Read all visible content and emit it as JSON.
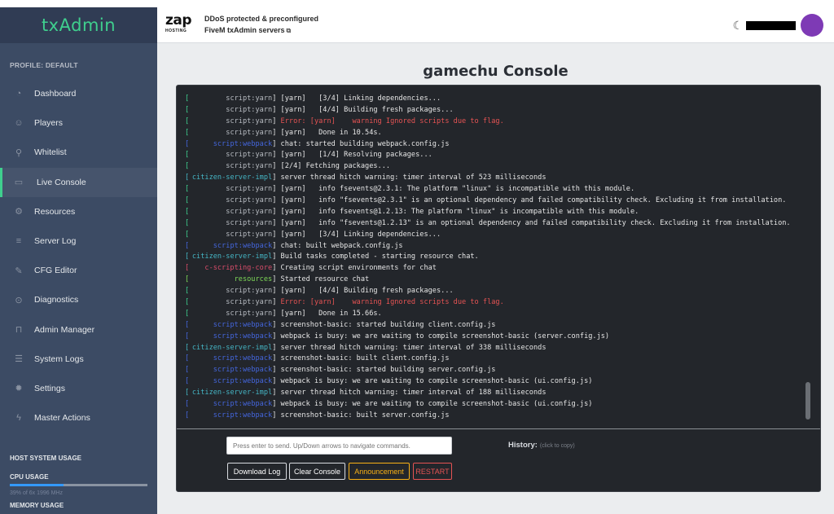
{
  "brand": {
    "name": "txAdmin",
    "accent": "#3fcf8e"
  },
  "sidebar": {
    "profile_title": "PROFILE: DEFAULT",
    "items": [
      {
        "label": "Dashboard",
        "icon": "speedometer-icon",
        "glyph": "◔"
      },
      {
        "label": "Players",
        "icon": "people-icon",
        "glyph": "☺"
      },
      {
        "label": "Whitelist",
        "icon": "user-icon",
        "glyph": "⚲"
      },
      {
        "label": "Live Console",
        "icon": "terminal-icon",
        "glyph": "▭",
        "active": true
      },
      {
        "label": "Resources",
        "icon": "puzzle-icon",
        "glyph": "⚙"
      },
      {
        "label": "Server Log",
        "icon": "list-icon",
        "glyph": "≡"
      },
      {
        "label": "CFG Editor",
        "icon": "pencil-icon",
        "glyph": "✎"
      },
      {
        "label": "Diagnostics",
        "icon": "medical-icon",
        "glyph": "⊙"
      },
      {
        "label": "Admin Manager",
        "icon": "book-icon",
        "glyph": "⊓"
      },
      {
        "label": "System Logs",
        "icon": "notes-icon",
        "glyph": "☰"
      },
      {
        "label": "Settings",
        "icon": "gear-icon",
        "glyph": "✹"
      },
      {
        "label": "Master Actions",
        "icon": "bolt-icon",
        "glyph": "ϟ"
      }
    ],
    "host_usage_title": "HOST SYSTEM USAGE",
    "cpu_title": "CPU USAGE",
    "cpu_usage_percent": 39,
    "cpu_detail": "39% of 6x 1996 MHz",
    "memory_title": "MEMORY USAGE"
  },
  "header": {
    "zap_logo_word": "zap",
    "zap_logo_sub": "HOSTING",
    "promo_line1": "DDoS protected & preconfigured",
    "promo_line2": "FiveM txAdmin servers",
    "ext_link_glyph": "⧉",
    "moon_glyph": "☾",
    "avatar_color": "#7e3ab5"
  },
  "page_title": "gamechu Console",
  "colors": {
    "yarn": "#b8bcc2",
    "error": "#e55353",
    "webpack": "#4466dd",
    "citizen": "#45b5c4",
    "scripting": "#d94c6a",
    "resources": "#7ed957",
    "bracket": "#e6e6e6"
  },
  "console": {
    "lines": [
      {
        "tag": "script:yarn",
        "tag_color": "#b8bcc2",
        "br_color": "#3fcf8e",
        "msg": "[yarn]   [3/4] Linking dependencies...",
        "err": false
      },
      {
        "tag": "script:yarn",
        "tag_color": "#b8bcc2",
        "br_color": "#3fcf8e",
        "msg": "[yarn]   [4/4] Building fresh packages...",
        "err": false
      },
      {
        "tag": "script:yarn",
        "tag_color": "#b8bcc2",
        "br_color": "#3fcf8e",
        "msg": "Error: [yarn]    warning Ignored scripts due to flag.",
        "err": true
      },
      {
        "tag": "script:yarn",
        "tag_color": "#b8bcc2",
        "br_color": "#3fcf8e",
        "msg": "[yarn]   Done in 10.54s.",
        "err": false
      },
      {
        "tag": "script:webpack",
        "tag_color": "#4466dd",
        "br_color": "#4466dd",
        "msg": "chat: started building webpack.config.js",
        "err": false
      },
      {
        "tag": "script:yarn",
        "tag_color": "#b8bcc2",
        "br_color": "#3fcf8e",
        "msg": "[yarn]   [1/4] Resolving packages...",
        "err": false
      },
      {
        "tag": "script:yarn",
        "tag_color": "#b8bcc2",
        "br_color": "#3fcf8e",
        "msg": "[2/4] Fetching packages...",
        "err": false
      },
      {
        "tag": "citizen-server-impl",
        "tag_color": "#45b5c4",
        "br_color": "#45b5c4",
        "msg": "server thread hitch warning: timer interval of 523 milliseconds",
        "err": false
      },
      {
        "tag": "script:yarn",
        "tag_color": "#b8bcc2",
        "br_color": "#3fcf8e",
        "msg": "[yarn]   info fsevents@2.3.1: The platform \"linux\" is incompatible with this module.",
        "err": false
      },
      {
        "tag": "script:yarn",
        "tag_color": "#b8bcc2",
        "br_color": "#3fcf8e",
        "msg": "[yarn]   info \"fsevents@2.3.1\" is an optional dependency and failed compatibility check. Excluding it from installation.",
        "err": false
      },
      {
        "tag": "script:yarn",
        "tag_color": "#b8bcc2",
        "br_color": "#3fcf8e",
        "msg": "[yarn]   info fsevents@1.2.13: The platform \"linux\" is incompatible with this module.",
        "err": false
      },
      {
        "tag": "script:yarn",
        "tag_color": "#b8bcc2",
        "br_color": "#3fcf8e",
        "msg": "[yarn]   info \"fsevents@1.2.13\" is an optional dependency and failed compatibility check. Excluding it from installation.",
        "err": false
      },
      {
        "tag": "script:yarn",
        "tag_color": "#b8bcc2",
        "br_color": "#3fcf8e",
        "msg": "[yarn]   [3/4] Linking dependencies...",
        "err": false
      },
      {
        "tag": "script:webpack",
        "tag_color": "#4466dd",
        "br_color": "#4466dd",
        "msg": "chat: built webpack.config.js",
        "err": false
      },
      {
        "tag": "citizen-server-impl",
        "tag_color": "#45b5c4",
        "br_color": "#45b5c4",
        "msg": "Build tasks completed - starting resource chat.",
        "err": false
      },
      {
        "tag": "c-scripting-core",
        "tag_color": "#d94c6a",
        "br_color": "#d94c6a",
        "msg": "Creating script environments for chat",
        "err": false
      },
      {
        "tag": "resources",
        "tag_color": "#7ed957",
        "br_color": "#7ed957",
        "msg": "Started resource chat",
        "err": false
      },
      {
        "tag": "script:yarn",
        "tag_color": "#b8bcc2",
        "br_color": "#3fcf8e",
        "msg": "[yarn]   [4/4] Building fresh packages...",
        "err": false
      },
      {
        "tag": "script:yarn",
        "tag_color": "#b8bcc2",
        "br_color": "#3fcf8e",
        "msg": "Error: [yarn]    warning Ignored scripts due to flag.",
        "err": true
      },
      {
        "tag": "script:yarn",
        "tag_color": "#b8bcc2",
        "br_color": "#3fcf8e",
        "msg": "[yarn]   Done in 15.66s.",
        "err": false
      },
      {
        "tag": "script:webpack",
        "tag_color": "#4466dd",
        "br_color": "#4466dd",
        "msg": "screenshot-basic: started building client.config.js",
        "err": false
      },
      {
        "tag": "script:webpack",
        "tag_color": "#4466dd",
        "br_color": "#4466dd",
        "msg": "webpack is busy: we are waiting to compile screenshot-basic (server.config.js)",
        "err": false
      },
      {
        "tag": "citizen-server-impl",
        "tag_color": "#45b5c4",
        "br_color": "#45b5c4",
        "msg": "server thread hitch warning: timer interval of 338 milliseconds",
        "err": false
      },
      {
        "tag": "script:webpack",
        "tag_color": "#4466dd",
        "br_color": "#4466dd",
        "msg": "screenshot-basic: built client.config.js",
        "err": false
      },
      {
        "tag": "script:webpack",
        "tag_color": "#4466dd",
        "br_color": "#4466dd",
        "msg": "screenshot-basic: started building server.config.js",
        "err": false
      },
      {
        "tag": "script:webpack",
        "tag_color": "#4466dd",
        "br_color": "#4466dd",
        "msg": "webpack is busy: we are waiting to compile screenshot-basic (ui.config.js)",
        "err": false
      },
      {
        "tag": "citizen-server-impl",
        "tag_color": "#45b5c4",
        "br_color": "#45b5c4",
        "msg": "server thread hitch warning: timer interval of 188 milliseconds",
        "err": false
      },
      {
        "tag": "script:webpack",
        "tag_color": "#4466dd",
        "br_color": "#4466dd",
        "msg": "webpack is busy: we are waiting to compile screenshot-basic (ui.config.js)",
        "err": false
      },
      {
        "tag": "script:webpack",
        "tag_color": "#4466dd",
        "br_color": "#4466dd",
        "msg": "screenshot-basic: built server.config.js",
        "err": false
      }
    ],
    "input_placeholder": "Press enter to send. Up/Down arrows to navigate commands.",
    "history_label": "History:",
    "history_hint": "(click to copy)",
    "buttons": {
      "download": "Download Log",
      "clear": "Clear Console",
      "announcement": "Announcement",
      "restart": "RESTART"
    }
  }
}
